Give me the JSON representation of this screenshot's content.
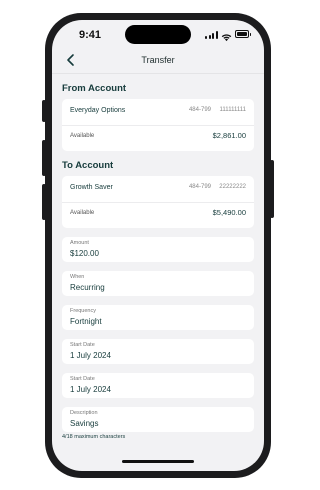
{
  "status_bar": {
    "time": "9:41"
  },
  "nav": {
    "title": "Transfer"
  },
  "from_account": {
    "section_title": "From Account",
    "name": "Everyday Options",
    "bsb": "484-799",
    "number": "111111111",
    "available_label": "Available",
    "available": "$2,861.00"
  },
  "to_account": {
    "section_title": "To Account",
    "name": "Growth Saver",
    "bsb": "484-799",
    "number": "22222222",
    "available_label": "Available",
    "available": "$5,490.00"
  },
  "fields": {
    "amount": {
      "label": "Amount",
      "value": "$120.00"
    },
    "when": {
      "label": "When",
      "value": "Recurring"
    },
    "frequency": {
      "label": "Frequency",
      "value": "Fortnight"
    },
    "start_date_1": {
      "label": "Start Date",
      "value": "1 July 2024"
    },
    "start_date_2": {
      "label": "Start Date",
      "value": "1 July 2024"
    },
    "description": {
      "label": "Description",
      "value": "Savings"
    }
  },
  "description_helper": "4/18 maximum characters",
  "colors": {
    "accent": "#173c3c",
    "background": "#f2f2f4",
    "card": "#ffffff"
  },
  "icons": {
    "back": "chevron-left-icon",
    "signal": "cellular-signal-icon",
    "wifi": "wifi-icon",
    "battery": "battery-icon"
  }
}
